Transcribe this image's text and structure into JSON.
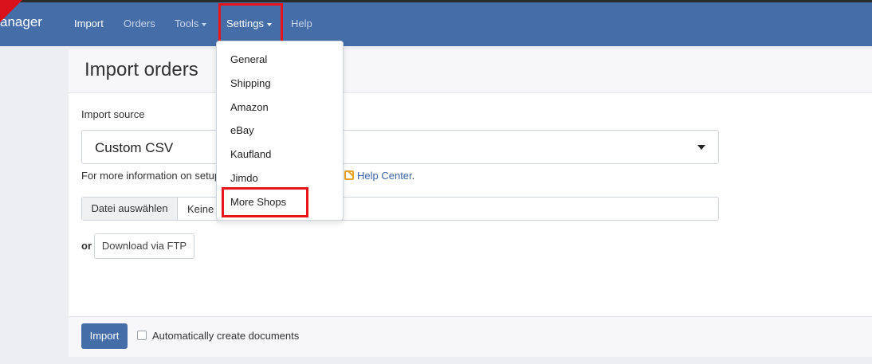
{
  "navbar": {
    "brand": "anager",
    "items": [
      {
        "label": "Import"
      },
      {
        "label": "Orders"
      },
      {
        "label": "Tools"
      },
      {
        "label": "Settings"
      },
      {
        "label": "Help"
      }
    ]
  },
  "settings_menu": {
    "items": [
      {
        "label": "General"
      },
      {
        "label": "Shipping"
      },
      {
        "label": "Amazon"
      },
      {
        "label": "eBay"
      },
      {
        "label": "Kaufland"
      },
      {
        "label": "Jimdo"
      },
      {
        "label": "More Shops"
      }
    ]
  },
  "page": {
    "title": "Import orders",
    "import_source_label": "Import source",
    "import_source_value": "Custom CSV",
    "info_text": "For more information on setup",
    "help_link": "Help Center",
    "help_link_suffix": ".",
    "file_button": "Datei auswählen",
    "file_name": "Keine",
    "or_label": "or",
    "ftp_button": "Download via FTP"
  },
  "footer": {
    "import_button": "Import",
    "auto_create_label": "Automatically create documents"
  },
  "colors": {
    "navbar": "#456ea9",
    "highlight": "#e8141c",
    "link": "#3a64a8"
  }
}
